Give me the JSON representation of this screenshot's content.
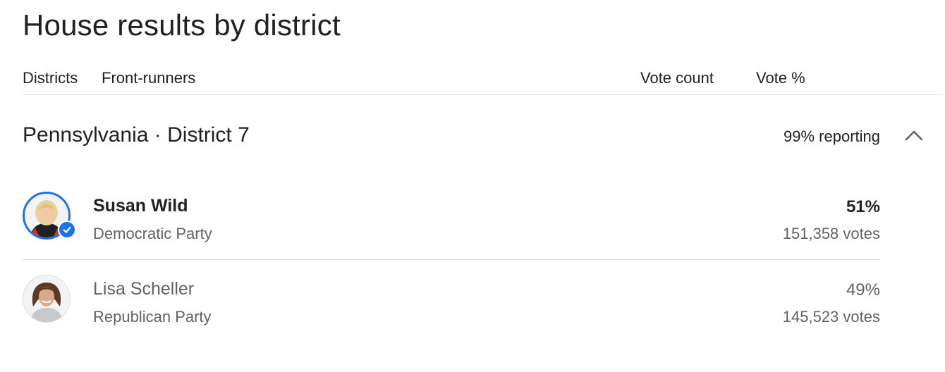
{
  "page": {
    "title": "House results by district"
  },
  "table_header": {
    "districts": "Districts",
    "front_runners": "Front-runners",
    "vote_count": "Vote count",
    "vote_pct": "Vote %"
  },
  "district": {
    "name": "Pennsylvania · District 7",
    "reporting": "99% reporting",
    "reporting_fraction": 0.99,
    "expanded": true,
    "collapse_icon": "chevron-up-icon"
  },
  "candidates": [
    {
      "name": "Susan Wild",
      "party": "Democratic Party",
      "vote_pct": "51%",
      "votes": "151,358 votes",
      "winner": true,
      "badge_icon": "check-circle-icon"
    },
    {
      "name": "Lisa Scheller",
      "party": "Republican Party",
      "vote_pct": "49%",
      "votes": "145,523 votes",
      "winner": false
    }
  ],
  "colors": {
    "text_primary": "#202124",
    "text_secondary": "#5f6368",
    "accent_blue": "#1a73e8",
    "divider": "#dadce0"
  }
}
